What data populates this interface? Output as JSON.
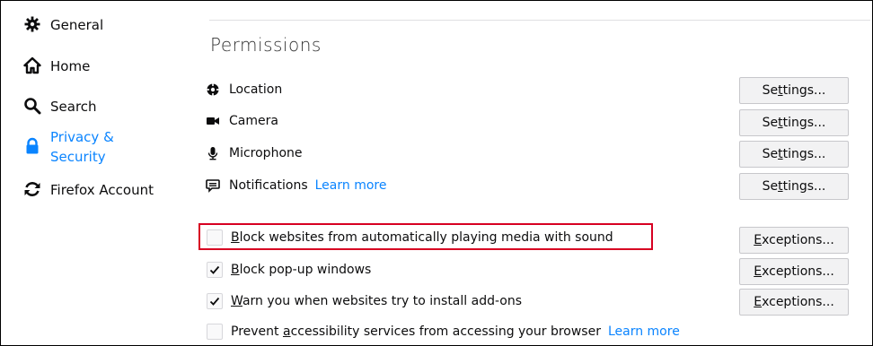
{
  "sidebar": {
    "items": [
      {
        "label": "General",
        "icon": "gear-icon"
      },
      {
        "label": "Home",
        "icon": "home-icon"
      },
      {
        "label": "Search",
        "icon": "search-icon"
      },
      {
        "label_line1": "Privacy &",
        "label_line2": "Security",
        "icon": "lock-icon",
        "selected": true
      },
      {
        "label": "Firefox Account",
        "icon": "sync-icon"
      }
    ]
  },
  "permissions": {
    "title": "Permissions",
    "rows": [
      {
        "label": "Location",
        "icon": "location-icon",
        "button": {
          "pre": "Se",
          "u": "t",
          "post": "tings..."
        }
      },
      {
        "label": "Camera",
        "icon": "camera-icon",
        "button": {
          "pre": "Se",
          "u": "t",
          "post": "tings..."
        }
      },
      {
        "label": "Microphone",
        "icon": "microphone-icon",
        "button": {
          "pre": "Se",
          "u": "t",
          "post": "tings..."
        }
      },
      {
        "label": "Notifications",
        "icon": "notifications-icon",
        "learn_more": "Learn more",
        "button": {
          "pre": "Se",
          "u": "t",
          "post": "tings..."
        }
      }
    ],
    "checkboxes": [
      {
        "u": "B",
        "rest": "lock websites from automatically playing media with sound",
        "checked": false,
        "button": {
          "u": "E",
          "post": "xceptions..."
        }
      },
      {
        "u": "B",
        "rest": "lock pop-up windows",
        "checked": true,
        "button": {
          "u": "E",
          "post": "xceptions..."
        }
      },
      {
        "u": "W",
        "rest": "arn you when websites try to install add-ons",
        "checked": true,
        "button": {
          "u": "E",
          "post": "xceptions..."
        }
      },
      {
        "pre": "Prevent ",
        "u": "a",
        "rest": "ccessibility services from accessing your browser",
        "learn_more": "Learn more",
        "checked": false
      }
    ]
  },
  "colors": {
    "accent": "#0a84ff",
    "highlight": "#d70022"
  }
}
